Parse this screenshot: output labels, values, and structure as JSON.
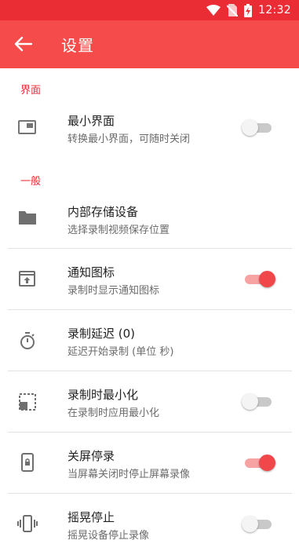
{
  "status_bar": {
    "time": "12:32",
    "icons": [
      "wifi-icon",
      "no-sim-icon",
      "battery-charging-icon"
    ]
  },
  "app_bar": {
    "title": "设置",
    "back_icon": "arrow-back-icon"
  },
  "accent_color": "#f54b4b",
  "sections": [
    {
      "header": "界面"
    },
    {
      "header": "一般"
    }
  ],
  "items": [
    {
      "title": "最小界面",
      "subtitle": "转换最小界面，可随时关闭",
      "icon": "minimize-window-icon",
      "toggle": false
    },
    {
      "title": "内部存储设备",
      "subtitle": "选择录制视频保存位置",
      "icon": "folder-icon"
    },
    {
      "title": "通知图标",
      "subtitle": "录制时显示通知图标",
      "icon": "notification-icon",
      "toggle": true
    },
    {
      "title": "录制延迟 (0)",
      "subtitle": "延迟开始录制 (单位 秒)",
      "icon": "timer-icon"
    },
    {
      "title": "录制时最小化",
      "subtitle": "在录制时应用最小化",
      "icon": "minimize-icon",
      "toggle": false
    },
    {
      "title": "关屏停录",
      "subtitle": "当屏幕关闭时停止屏幕录像",
      "icon": "lock-phone-icon",
      "toggle": true
    },
    {
      "title": "摇晃停止",
      "subtitle": "摇晃设备停止录像",
      "icon": "vibrate-icon",
      "toggle": false
    }
  ]
}
